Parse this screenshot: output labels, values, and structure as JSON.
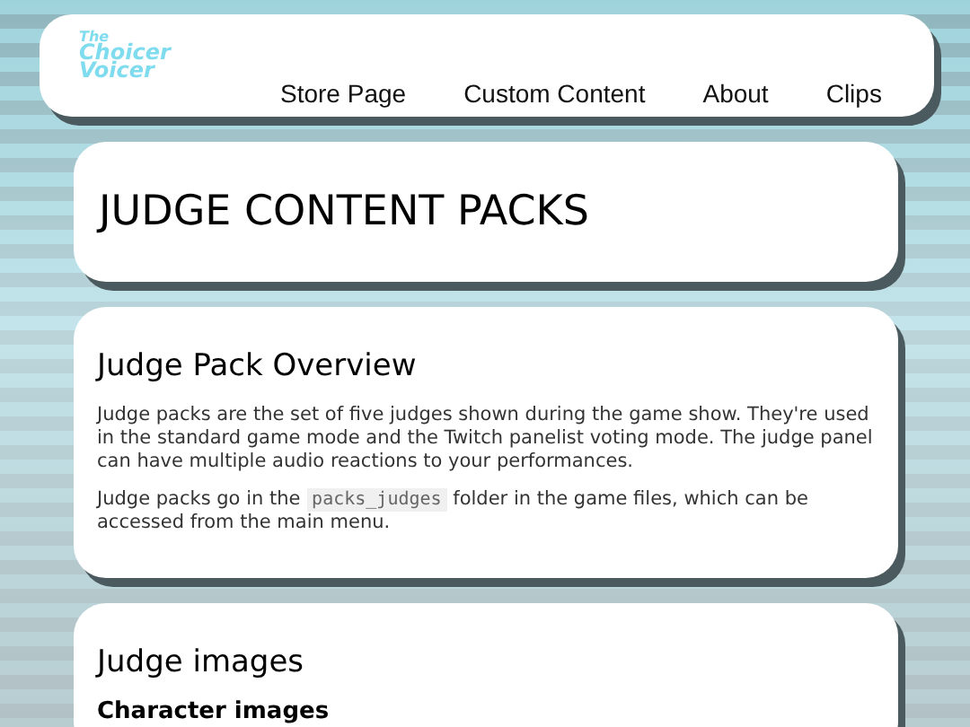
{
  "logo": {
    "lines": [
      "The",
      "Choicer",
      "Voicer"
    ]
  },
  "nav": [
    {
      "label": "Store Page"
    },
    {
      "label": "Custom Content"
    },
    {
      "label": "About"
    },
    {
      "label": "Clips"
    }
  ],
  "page_title": "JUDGE CONTENT PACKS",
  "sections": [
    {
      "heading": "Judge Pack Overview",
      "paragraphs": [
        [
          {
            "kind": "text",
            "text": "Judge packs are the set of five judges shown during the game show. They're used in the standard game mode and the Twitch panelist voting mode. The judge panel can have multiple audio reactions to your performances."
          }
        ],
        [
          {
            "kind": "text",
            "text": "Judge packs go in the "
          },
          {
            "kind": "code",
            "text": "packs_judges"
          },
          {
            "kind": "text",
            "text": " folder in the game files, which can be accessed from the main menu."
          }
        ]
      ]
    },
    {
      "heading": "Judge images",
      "subheading": "Character images"
    }
  ]
}
